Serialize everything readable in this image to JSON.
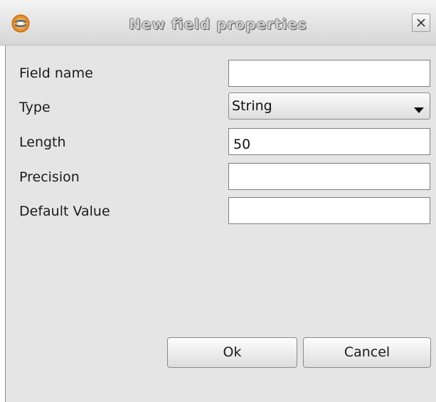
{
  "window": {
    "title": "New field properties",
    "app_icon": "gvsig-globe-icon",
    "close_icon": "close-icon"
  },
  "form": {
    "field_name": {
      "label": "Field name",
      "value": ""
    },
    "type": {
      "label": "Type",
      "selected": "String"
    },
    "length": {
      "label": "Length",
      "value": "50"
    },
    "precision": {
      "label": "Precision",
      "value": ""
    },
    "default_value": {
      "label": "Default Value",
      "value": ""
    }
  },
  "buttons": {
    "ok_label": "Ok",
    "cancel_label": "Cancel"
  },
  "colors": {
    "panel_background": "#e5e5e5",
    "field_background": "#ffffff",
    "title_text": "#cfcfcf"
  }
}
